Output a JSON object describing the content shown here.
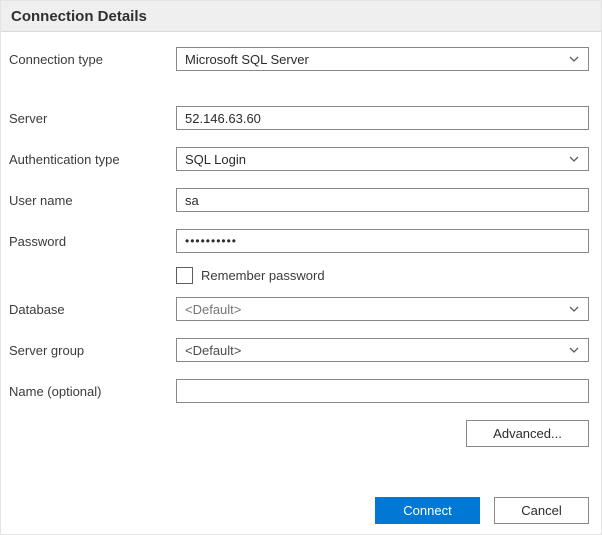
{
  "dialog": {
    "title": "Connection Details"
  },
  "fields": {
    "connection_type": {
      "label": "Connection type",
      "value": "Microsoft SQL Server"
    },
    "server": {
      "label": "Server",
      "value": "52.146.63.60"
    },
    "authentication_type": {
      "label": "Authentication type",
      "value": "SQL Login"
    },
    "user_name": {
      "label": "User name",
      "value": "sa"
    },
    "password": {
      "label": "Password",
      "value": "••••••••••"
    },
    "remember_password": {
      "label": "Remember password",
      "checked": false
    },
    "database": {
      "label": "Database",
      "value": "<Default>"
    },
    "server_group": {
      "label": "Server group",
      "value": "<Default>"
    },
    "name_optional": {
      "label": "Name (optional)",
      "value": "",
      "placeholder": ""
    }
  },
  "buttons": {
    "advanced": "Advanced...",
    "connect": "Connect",
    "cancel": "Cancel"
  },
  "colors": {
    "accent": "#0078d4",
    "header_bg": "#efefef",
    "input_border": "#8a8886",
    "muted_text": "#767676"
  }
}
